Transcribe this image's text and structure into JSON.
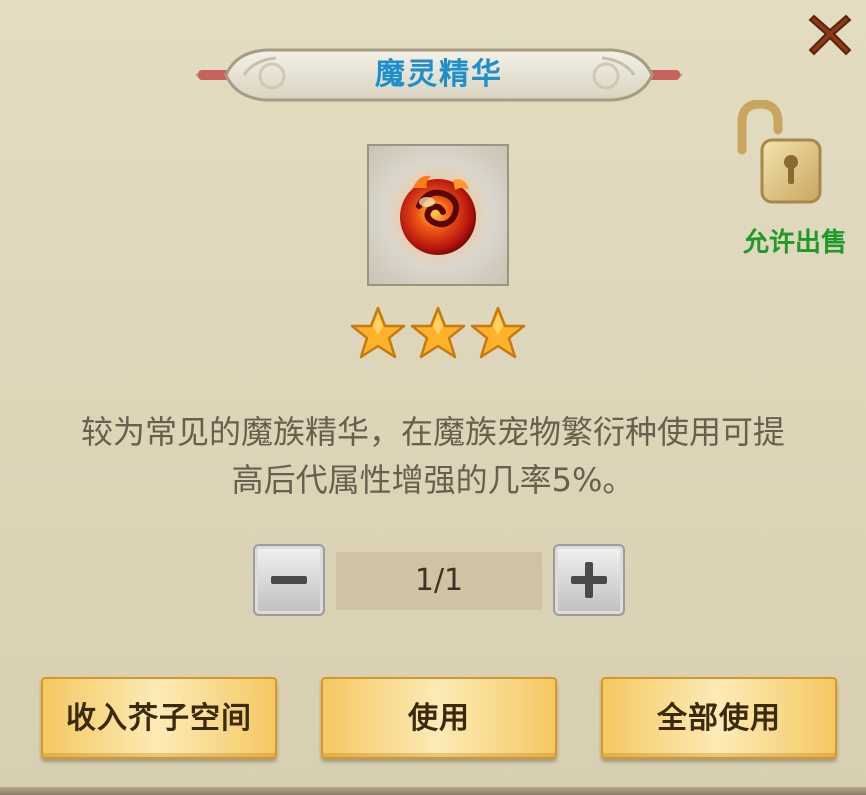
{
  "dialog": {
    "title": "魔灵精华",
    "item_icon": "fire-essence-orb-icon",
    "rarity_stars": 3,
    "description_line1": "较为常见的魔族精华，在魔族宠物繁衍种使用可提",
    "description_line2": "高后代属性增强的几率5%。",
    "sell_status": "允许出售",
    "quantity": {
      "display": "1/1",
      "minus_label": "−",
      "plus_label": "+"
    },
    "buttons": {
      "store": "收入芥子空间",
      "use": "使用",
      "use_all": "全部使用"
    }
  },
  "colors": {
    "title": "#1e8fcb",
    "sell_label": "#1f9a2a",
    "button_gold": "#f5c862",
    "close": "#8a3a18"
  }
}
